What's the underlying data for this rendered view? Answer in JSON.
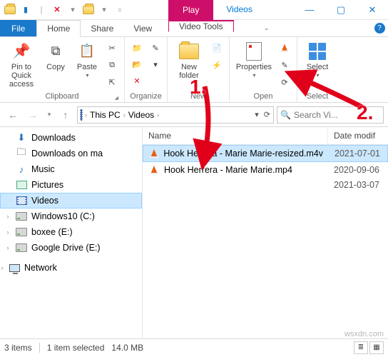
{
  "window": {
    "context_tab": "Play",
    "context_title": "Videos",
    "tools_label": "Video Tools"
  },
  "tabs": {
    "file": "File",
    "home": "Home",
    "share": "Share",
    "view": "View"
  },
  "ribbon": {
    "clipboard": {
      "label": "Clipboard",
      "pin": "Pin to Quick\naccess",
      "copy": "Copy",
      "paste": "Paste"
    },
    "organize": {
      "label": "Organize"
    },
    "new": {
      "label": "New",
      "newfolder": "New\nfolder"
    },
    "open": {
      "label": "Open",
      "properties": "Properties"
    },
    "select": {
      "label": "Select",
      "select": "Select"
    }
  },
  "address": {
    "root": "This PC",
    "folder": "Videos"
  },
  "search": {
    "placeholder": "Search Vi..."
  },
  "nav": {
    "downloads": "Downloads",
    "downloads_ma": "Downloads on ma",
    "music": "Music",
    "pictures": "Pictures",
    "videos": "Videos",
    "windows10": "Windows10 (C:)",
    "boxee": "boxee (E:)",
    "googledrive": "Google Drive (E:)",
    "network": "Network"
  },
  "columns": {
    "name": "Name",
    "date": "Date modif"
  },
  "files": [
    {
      "name": "Hook Herrera - Marie Marie-resized.m4v",
      "date": "2021-07-01"
    },
    {
      "name": "Hook Herrera - Marie Marie.mp4",
      "date": "2020-09-06"
    },
    {
      "name": "",
      "date": "2021-03-07"
    }
  ],
  "status": {
    "items": "3 items",
    "selected": "1 item selected",
    "size": "14.0 MB"
  },
  "annotations": {
    "one": "1.",
    "two": "2."
  },
  "watermark": "wsxdn.com"
}
